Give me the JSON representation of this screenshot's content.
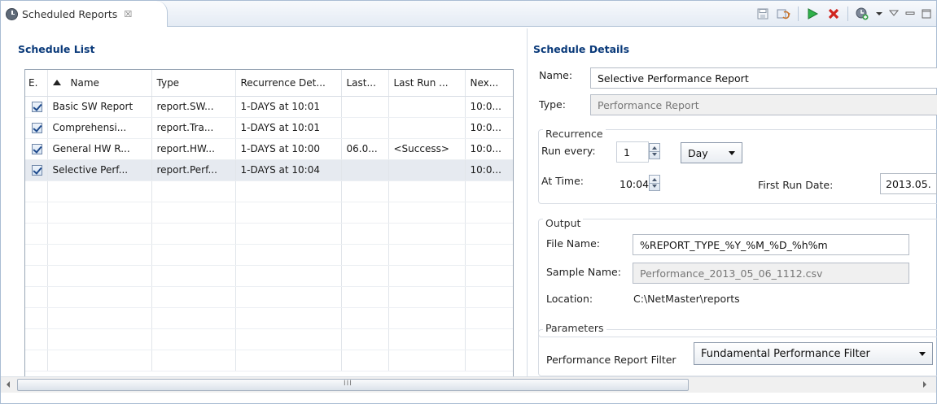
{
  "tab": {
    "title": "Scheduled Reports",
    "close": "☒"
  },
  "toolbar": {
    "icons": [
      "save-icon",
      "refresh-icon",
      "run-icon",
      "delete-icon",
      "add-schedule-icon",
      "view-menu-icon",
      "minimize-icon",
      "maximize-icon"
    ]
  },
  "schedule_list": {
    "title": "Schedule List",
    "columns": [
      "E.",
      "Name",
      "Type",
      "Recurrence Det...",
      "Last...",
      "Last Run ...",
      "Nex..."
    ],
    "rows": [
      {
        "enabled": true,
        "name": "Basic SW Report",
        "type": "report.SW...",
        "recurrence": "1-DAYS  at 10:01",
        "last": "",
        "last_run": "",
        "next": "10:0..."
      },
      {
        "enabled": true,
        "name": "Comprehensi...",
        "type": "report.Tra...",
        "recurrence": "1-DAYS  at 10:01",
        "last": "",
        "last_run": "",
        "next": "10:0..."
      },
      {
        "enabled": true,
        "name": "General HW R...",
        "type": "report.HW...",
        "recurrence": "1-DAYS  at 10:00",
        "last": "06.0...",
        "last_run": "<Success>",
        "next": "10:0..."
      },
      {
        "enabled": true,
        "name": "Selective Perf...",
        "type": "report.Perf...",
        "recurrence": "1-DAYS  at 10:04",
        "last": "",
        "last_run": "",
        "next": "10:0..."
      }
    ],
    "selected_row": 3
  },
  "details": {
    "title": "Schedule Details",
    "name_label": "Name:",
    "name_value": "Selective Performance Report",
    "type_label": "Type:",
    "type_value": "Performance Report",
    "recurrence": {
      "title": "Recurrence",
      "run_every_label": "Run every:",
      "run_every_value": "1",
      "unit": "Day",
      "at_time_label": "At Time:",
      "at_time_value": "10:04",
      "first_run_label": "First Run Date:",
      "first_run_value": "2013.05."
    },
    "output": {
      "title": "Output",
      "file_name_label": "File Name:",
      "file_name_value": "%REPORT_TYPE_%Y_%M_%D_%h%m",
      "sample_name_label": "Sample Name:",
      "sample_name_value": "Performance_2013_05_06_1112.csv",
      "location_label": "Location:",
      "location_value": "C:\\NetMaster\\reports"
    },
    "parameters": {
      "title": "Parameters",
      "filter_label": "Performance Report Filter",
      "filter_value": "Fundamental Performance Filter"
    }
  },
  "scrollbar": {
    "grip": "III"
  }
}
